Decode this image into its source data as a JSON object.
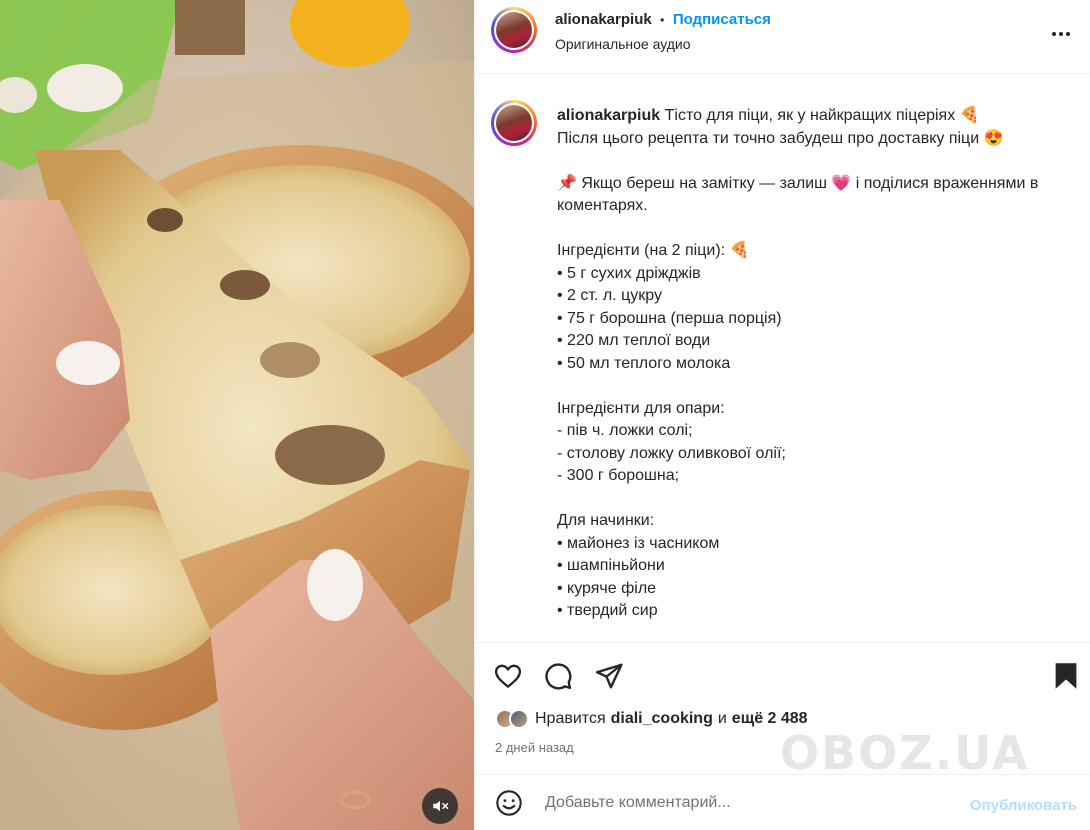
{
  "header": {
    "username": "alionakarpiuk",
    "dot": "•",
    "follow_label": "Подписаться",
    "audio": "Оригинальное аудио"
  },
  "caption": {
    "username": "alionakarpiuk",
    "lines": [
      "Тісто для піци, як у найкращих піцеріях 🍕",
      "Після цього рецепта ти точно забудеш про доставку піци 😍",
      "",
      "📌 Якщо береш на замітку — залиш 💗 і поділися враженнями в коментарях.",
      "",
      "Інгредієнти (на 2 піци): 🍕",
      "• 5 г сухих дріжджів",
      "• 2 ст. л. цукру",
      "• 75 г борошна (перша порція)",
      "• 220 мл теплої води",
      "• 50 мл теплого молока",
      "",
      "Інгредієнти для опари:",
      "- пів ч. ложки солі;",
      "- столову ложку оливкової олії;",
      "- 300 г борошна;",
      "",
      "Для начинки:",
      "• майонез із часником",
      "• шампіньйони",
      "• куряче філе",
      "• твердий сир"
    ]
  },
  "actions": {
    "like_icon": "heart-icon",
    "comment_icon": "comment-icon",
    "share_icon": "share-icon",
    "save_icon": "bookmark-icon"
  },
  "likes": {
    "prefix": "Нравится",
    "user": "diali_cooking",
    "middle": "и",
    "count": "ещё 2 488"
  },
  "time": "2 дней назад",
  "comment": {
    "placeholder": "Добавьте комментарий...",
    "publish_label": "Опубликовать",
    "emoji_icon": "smiley-icon"
  },
  "watermark": "OBOZ.UA",
  "colors": {
    "accent": "#0095f6",
    "publish_disabled": "#b2dffc",
    "muted": "#737373"
  }
}
